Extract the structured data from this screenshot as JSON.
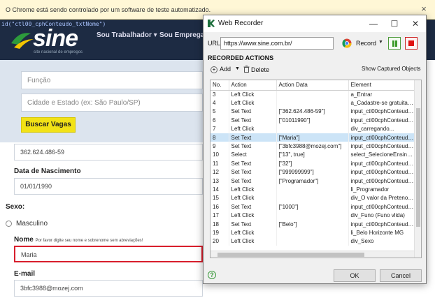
{
  "infobar": {
    "text": "O Chrome está sendo controlado por um software de teste automatizado.",
    "close": "×"
  },
  "locator": "id(\"ctl00_cphConteudo_txtNome\")",
  "site": {
    "logo": "sine",
    "logo_sub": "site nacional de empregos",
    "nav": [
      "Sou Trabalhador ▾",
      "Sou Empregad"
    ],
    "search": {
      "funcao_placeholder": "Função",
      "cidade_placeholder": "Cidade e Estado (ex: São Paulo/SP)",
      "button": "Buscar Vagas"
    },
    "form": {
      "cpf_value": "362.624.486-59",
      "nascimento_label": "Data de Nascimento",
      "nascimento_value": "01/01/1990",
      "sexo_label": "Sexo:",
      "masculino_label": "Masculino",
      "nome_label": "Nome",
      "nome_hint": "Por favor digite seu nome e sobrenome sem abreviações!",
      "nome_value": "Maria",
      "email_label": "E-mail",
      "email_value": "3bfc3988@mozej.com"
    }
  },
  "recorder": {
    "title": "Web Recorder",
    "window_controls": [
      "—",
      "☐",
      "✕"
    ],
    "url_label": "URL",
    "url_value": "https://www.sine.com.br/",
    "record_label": "Record",
    "section_title": "RECORDED ACTIONS",
    "add_label": "Add",
    "delete_label": "Delete",
    "show_captured_label": "Show Captured Objects",
    "columns": [
      "No.",
      "Action",
      "Action Data",
      "Element"
    ],
    "rows": [
      [
        "3",
        "Left Click",
        "",
        "a_Entrar"
      ],
      [
        "4",
        "Left Click",
        "",
        "a_Cadastre-se gratuitame"
      ],
      [
        "5",
        "Set Text",
        "[\"362.624.486-59\"]",
        "input_ctl00cphConteudo..."
      ],
      [
        "6",
        "Set Text",
        "[\"01011990\"]",
        "input_ctl00cphConteudo..."
      ],
      [
        "7",
        "Left Click",
        "",
        "div_carregando..."
      ],
      [
        "8",
        "Set Text",
        "[\"Maria\"]",
        "input_ctl00cphConteudo..."
      ],
      [
        "9",
        "Set Text",
        "[\"3bfc3988@mozej.com\"]",
        "input_ctl00cphConteudo..."
      ],
      [
        "10",
        "Select",
        "[\"13\", true]",
        "select_SelecioneEnsino F..."
      ],
      [
        "11",
        "Set Text",
        "[\"32\"]",
        "input_ctl00cphConteudo..."
      ],
      [
        "12",
        "Set Text",
        "[\"999999999\"]",
        "input_ctl00cphConteudo..."
      ],
      [
        "13",
        "Set Text",
        "[\"Programador\"]",
        "input_ctl00cphConteudo..."
      ],
      [
        "14",
        "Left Click",
        "",
        "li_Programador"
      ],
      [
        "15",
        "Left Click",
        "",
        "div_O valor da Preteno Sa"
      ],
      [
        "16",
        "Set Text",
        "[\"1000\"]",
        "input_ctl00cphConteudo..."
      ],
      [
        "17",
        "Left Click",
        "",
        "div_Funo (Funo vlida)"
      ],
      [
        "18",
        "Set Text",
        "[\"Belo\"]",
        "input_ctl00cphConteudo..."
      ],
      [
        "19",
        "Left Click",
        "",
        "li_Belo Horizonte  MG"
      ],
      [
        "20",
        "Left Click",
        "",
        "div_Sexo"
      ]
    ],
    "selected_row": "8",
    "ok_label": "OK",
    "cancel_label": "Cancel",
    "help": "?"
  },
  "colors": {
    "header": "#1d2b43",
    "search_button": "#f2e216",
    "error_border": "#d81e2c",
    "selected_row": "#cce4f7",
    "record_stop": "#e01010",
    "record_pause": "#3d9b2a"
  }
}
